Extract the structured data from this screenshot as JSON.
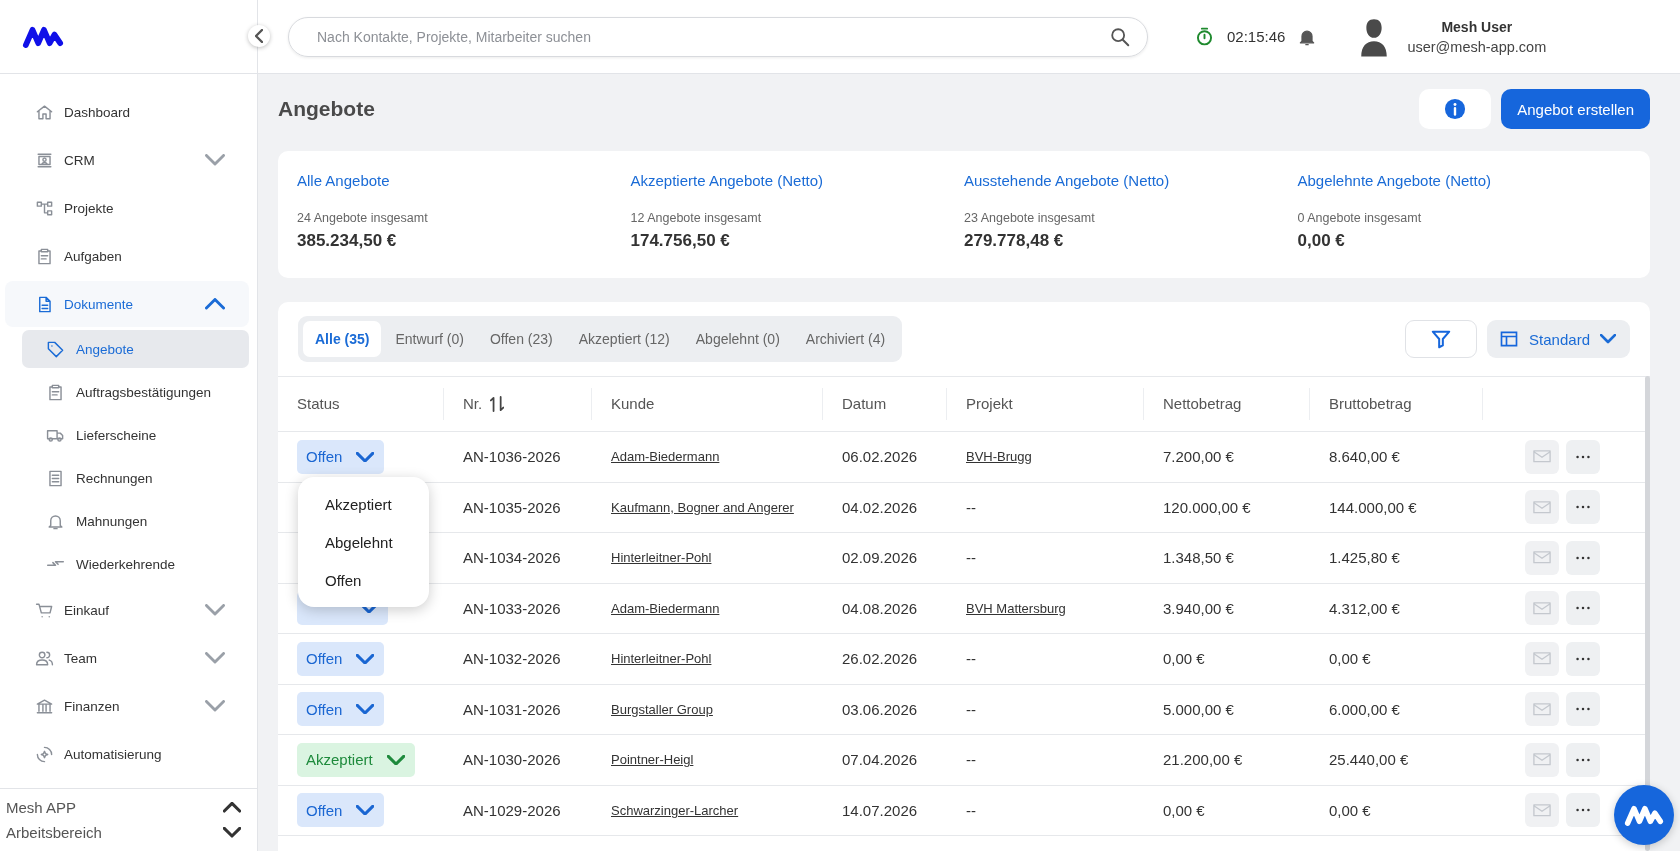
{
  "sidebar": {
    "items": [
      {
        "label": "Dashboard",
        "selected": false
      },
      {
        "label": "CRM",
        "selected": false,
        "expanded": false
      },
      {
        "label": "Projekte",
        "selected": false
      },
      {
        "label": "Aufgaben",
        "selected": false
      },
      {
        "label": "Dokumente",
        "selected": true,
        "expanded": true,
        "children": [
          {
            "label": "Angebote",
            "selected": true
          },
          {
            "label": "Auftragsbestätigungen",
            "selected": false
          },
          {
            "label": "Lieferscheine",
            "selected": false
          },
          {
            "label": "Rechnungen",
            "selected": false
          },
          {
            "label": "Mahnungen",
            "selected": false
          },
          {
            "label": "Wiederkehrende",
            "selected": false
          }
        ]
      },
      {
        "label": "Einkauf",
        "selected": false,
        "expanded": false
      },
      {
        "label": "Team",
        "selected": false,
        "expanded": false
      },
      {
        "label": "Finanzen",
        "selected": false,
        "expanded": false
      },
      {
        "label": "Automatisierung",
        "selected": false
      }
    ],
    "workspace": {
      "app": "Mesh APP",
      "area": "Arbeitsbereich"
    }
  },
  "topbar": {
    "search": {
      "placeholder": "Nach Kontakte, Projekte, Mitarbeiter suchen"
    },
    "timer": "02:15:46",
    "user": {
      "name": "Mesh User",
      "email": "user@mesh-app.com"
    }
  },
  "page": {
    "title": "Angebote",
    "create_button": "Angebot erstellen"
  },
  "stats": [
    {
      "title": "Alle Angebote",
      "count": "24 Angebote insgesamt",
      "amount": "385.234,50 €"
    },
    {
      "title": "Akzeptierte Angebote (Netto)",
      "count": "12 Angebote insgesamt",
      "amount": "174.756,50 €"
    },
    {
      "title": "Ausstehende Angebote (Netto)",
      "count": "23 Angebote insgesamt",
      "amount": "279.778,48 €"
    },
    {
      "title": "Abgelehnte Angebote (Netto)",
      "count": "0 Angebote insgesamt",
      "amount": "0,00 €"
    }
  ],
  "tabs": [
    {
      "label": "Alle (35)",
      "selected": true
    },
    {
      "label": "Entwurf (0)",
      "selected": false
    },
    {
      "label": "Offen (23)",
      "selected": false
    },
    {
      "label": "Akzeptiert (12)",
      "selected": false
    },
    {
      "label": "Abgelehnt (0)",
      "selected": false
    },
    {
      "label": "Archiviert (4)",
      "selected": false
    }
  ],
  "view_button": "Standard",
  "table": {
    "columns": [
      {
        "label": "Status",
        "sortable": false
      },
      {
        "label": "Nr.",
        "sortable": true
      },
      {
        "label": "Kunde",
        "sortable": false
      },
      {
        "label": "Datum",
        "sortable": false
      },
      {
        "label": "Projekt",
        "sortable": false
      },
      {
        "label": "Nettobetrag",
        "sortable": false
      },
      {
        "label": "Bruttobetrag",
        "sortable": false
      }
    ],
    "status_menu": [
      "Akzeptiert",
      "Abgelehnt",
      "Offen"
    ],
    "rows": [
      {
        "status": {
          "label": "Offen",
          "kind": "offen",
          "menu_open": true
        },
        "number": "AN-1036-2026",
        "customer": "Adam-Biedermann",
        "date": "06.02.2026",
        "project": {
          "text": "BVH-Brugg",
          "link": true
        },
        "net": "7.200,00 €",
        "gross": "8.640,00 €"
      },
      {
        "number": "AN-1035-2026",
        "customer": "Kaufmann, Bogner and Angerer",
        "date": "04.02.2026",
        "project": {
          "text": "--",
          "link": false
        },
        "net": "120.000,00 €",
        "gross": "144.000,00 €"
      },
      {
        "number": "AN-1034-2026",
        "customer": "Hinterleitner-Pohl",
        "date": "02.09.2026",
        "project": {
          "text": "--",
          "link": false
        },
        "net": "1.348,50 €",
        "gross": "1.425,80 €"
      },
      {
        "status": {
          "kind": "offen"
        },
        "number": "AN-1033-2026",
        "customer": "Adam-Biedermann",
        "date": "04.08.2026",
        "project": {
          "text": "BVH Mattersburg",
          "link": true
        },
        "net": "3.940,00 €",
        "gross": "4.312,00 €"
      },
      {
        "status": {
          "label": "Offen",
          "kind": "offen"
        },
        "number": "AN-1032-2026",
        "customer": "Hinterleitner-Pohl",
        "date": "26.02.2026",
        "project": {
          "text": "--",
          "link": false
        },
        "net": "0,00 €",
        "gross": "0,00 €"
      },
      {
        "status": {
          "label": "Offen",
          "kind": "offen"
        },
        "number": "AN-1031-2026",
        "customer": "Burgstaller Group",
        "date": "03.06.2026",
        "project": {
          "text": "--",
          "link": false
        },
        "net": "5.000,00 €",
        "gross": "6.000,00 €"
      },
      {
        "status": {
          "label": "Akzeptiert",
          "kind": "akzeptiert"
        },
        "number": "AN-1030-2026",
        "customer": "Pointner-Heigl",
        "date": "07.04.2026",
        "project": {
          "text": "--",
          "link": false
        },
        "net": "21.200,00 €",
        "gross": "25.440,00 €"
      },
      {
        "status": {
          "label": "Offen",
          "kind": "offen"
        },
        "number": "AN-1029-2026",
        "customer": "Schwarzinger-Larcher",
        "date": "14.07.2026",
        "project": {
          "text": "--",
          "link": false
        },
        "net": "0,00 €",
        "gross": "0,00 €"
      }
    ]
  }
}
